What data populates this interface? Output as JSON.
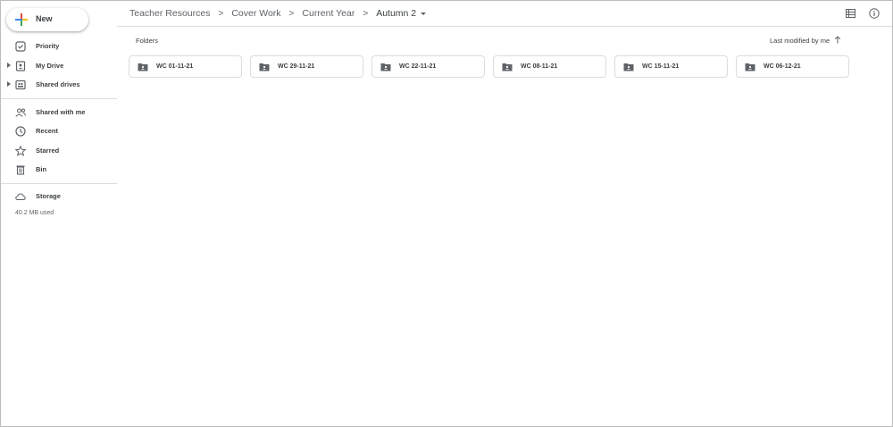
{
  "sidebar": {
    "new_label": "New",
    "items": [
      {
        "label": "Priority",
        "icon": "priority-check-icon",
        "expandable": false
      },
      {
        "label": "My Drive",
        "icon": "my-drive-icon",
        "expandable": true
      },
      {
        "label": "Shared drives",
        "icon": "shared-drives-icon",
        "expandable": true
      },
      {
        "label": "Shared with me",
        "icon": "shared-with-me-icon",
        "expandable": false
      },
      {
        "label": "Recent",
        "icon": "clock-icon",
        "expandable": false
      },
      {
        "label": "Starred",
        "icon": "star-icon",
        "expandable": false
      },
      {
        "label": "Bin",
        "icon": "bin-icon",
        "expandable": false
      },
      {
        "label": "Storage",
        "icon": "cloud-icon",
        "expandable": false
      }
    ],
    "storage_used": "40.2 MB used"
  },
  "header": {
    "breadcrumb": [
      "Teacher Resources",
      "Cover Work",
      "Current Year",
      "Autumn 2"
    ],
    "separator": ">"
  },
  "content": {
    "section_title": "Folders",
    "sort_label": "Last modified by me",
    "folders": [
      "WC 01-11-21",
      "WC 29-11-21",
      "WC 22-11-21",
      "WC 08-11-21",
      "WC 15-11-21",
      "WC 06-12-21"
    ]
  },
  "colors": {
    "text": "#3c4043",
    "muted": "#5f6368",
    "border": "#dadce0",
    "brand_blue": "#4285f4",
    "brand_red": "#ea4335",
    "brand_yellow": "#fbbc04",
    "brand_green": "#34a853"
  }
}
